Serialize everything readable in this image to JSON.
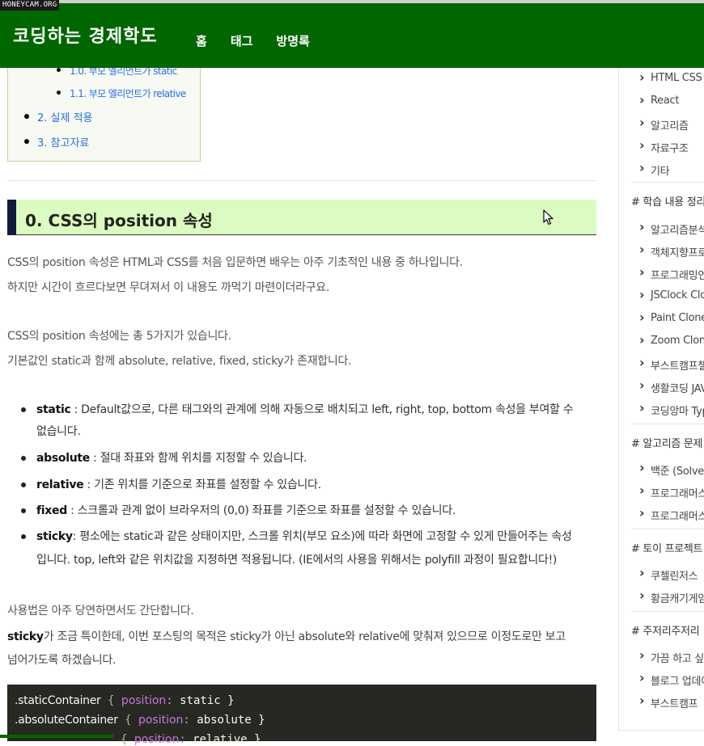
{
  "watermark": "HONEYCAM.ORG",
  "header": {
    "logo": "코딩하는 경제학도",
    "nav": [
      "홈",
      "태그",
      "방명록"
    ]
  },
  "toc": {
    "items": [
      {
        "label": "1.0. 부모 엘리먼트가 static"
      },
      {
        "label": "1.1. 부모 엘리먼트가 relative"
      },
      {
        "label": "2. 실제 적용"
      },
      {
        "label": "3. 참고자료"
      }
    ]
  },
  "heading": "0. CSS의 position 속성",
  "paragraphs": {
    "p1": "CSS의 position 속성은 HTML과 CSS를 처음 입문하면 배우는 아주 기초적인 내용 중 하나입니다.",
    "p2": "하지만 시간이 흐르다보면 무뎌져서 이 내용도 까먹기 마련이더라구요.",
    "p3": "CSS의 position 속성에는 총 5가지가 있습니다.",
    "p4": "기본값인 static과 함께 absolute, relative, fixed, sticky가 존재합니다.",
    "p5": "사용법은 아주 당연하면서도 간단합니다.",
    "p6_bold": "sticky",
    "p6_rest": "가 조금 특이한데, 이번 포스팅의 목적은 sticky가 아닌 absolute와 relative에 맞춰져 있으므로 이정도로만 보고",
    "p7": "넘어가도록 하겠습니다."
  },
  "bullets": [
    {
      "term": "static",
      "text": " : Default값으로, 다른 태그와의 관계에 의해 자동으로 배치되고 left, right, top, bottom 속성을 부여할 수",
      "cont": "없습니다."
    },
    {
      "term": "absolute",
      "text": " : 절대 좌표와 함께 위치를 지정할 수 있습니다.",
      "cont": ""
    },
    {
      "term": "relative",
      "text": " : 기존 위치를 기준으로 좌표를 설정할 수 있습니다.",
      "cont": ""
    },
    {
      "term": "fixed",
      "text": " : 스크롤과 관계 없이 브라우저의 (0,0) 좌표를 기준으로 좌표를 설정할 수 있습니다.",
      "cont": ""
    },
    {
      "term": "sticky",
      "text": ": 평소에는 static과 같은 상태이지만, 스크롤 위치(부모 요소)에 따라 화면에 고정할 수 있게 만들어주는 속성",
      "cont": "입니다. top, left와 같은 위치값을 지정하면 적용됩니다. (IE에서의 사용을 위해서는 polyfill 과정이 필요합니다!)"
    }
  ],
  "code": [
    {
      "selector": ".staticContainer",
      "open": " { ",
      "prop": "position",
      "colon": ": ",
      "value": "static",
      "close": " }"
    },
    {
      "selector": ".absoluteContainer",
      "open": " { ",
      "prop": "position",
      "colon": ": ",
      "value": "absolute",
      "close": " }"
    },
    {
      "selector": "",
      "open": "{ ",
      "prop": "position",
      "colon": ": ",
      "value": "relative",
      "close": " }"
    }
  ],
  "sidebar": {
    "groups": [
      {
        "title": "",
        "items": [
          "HTML CSS",
          "React",
          "알고리즘",
          "자료구조",
          "기타"
        ]
      },
      {
        "title": "# 학습 내용 정리",
        "items": [
          "알고리즘분석",
          "객체지향프로그래밍",
          "프로그래밍언어",
          "JSClock Clone",
          "Paint Clone",
          "Zoom Clone",
          "부스트캠프챌린지",
          "생활코딩 JAVA",
          "코딩앙마 TypeScript"
        ]
      },
      {
        "title": "# 알고리즘 문제",
        "items": [
          "백준 (Solved)",
          "프로그래머스",
          "프로그래머스"
        ]
      },
      {
        "title": "# 토이 프로젝트",
        "items": [
          "쿠첼린저스",
          "황금캐기게임"
        ]
      },
      {
        "title": "# 주저리주저리",
        "items": [
          "가끔 하고 싶은 말",
          "블로그 업데이트",
          "부스트캠프"
        ]
      }
    ]
  }
}
